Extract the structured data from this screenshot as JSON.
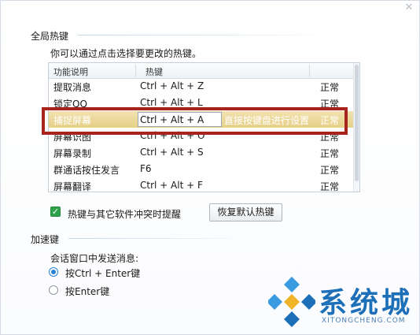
{
  "dialog": {
    "close_icon": "close-icon"
  },
  "global_hotkeys": {
    "section_title": "全局热键",
    "hint": "你可以通过点击选择要更改的热键。",
    "columns": {
      "function": "功能说明",
      "hotkey": "热键"
    },
    "rows": [
      {
        "function": "提取消息",
        "hotkey": "Ctrl + Alt + Z",
        "status": "正常"
      },
      {
        "function": "锁定QQ",
        "hotkey": "Ctrl + Alt + L",
        "status": "正常"
      },
      {
        "function": "捕捉屏幕",
        "hotkey": "Ctrl + Alt + A",
        "edit_hint": "直接按键盘进行设置",
        "status": "正常"
      },
      {
        "function": "屏幕识图",
        "hotkey": "Ctrl + Alt + O",
        "status": "正常"
      },
      {
        "function": "屏幕录制",
        "hotkey": "Ctrl + Alt + S",
        "status": "正常"
      },
      {
        "function": "群通话按住发言",
        "hotkey": "F6",
        "status": "正常"
      },
      {
        "function": "屏幕翻译",
        "hotkey": "Ctrl + Alt + F",
        "status": "正常"
      }
    ],
    "conflict_checkbox_label": "热键与其它软件冲突时提醒",
    "conflict_checked": true,
    "restore_button": "恢复默认热键"
  },
  "accelerator": {
    "section_title": "加速键",
    "send_label": "会话窗口中发送消息:",
    "options": [
      {
        "label": "按Ctrl + Enter键",
        "checked": true
      },
      {
        "label": "按Enter键",
        "checked": false
      }
    ]
  },
  "watermark": {
    "text": "系统城",
    "sub": "XITONGCHENG.COM"
  },
  "colors": {
    "highlight_border": "#a8231b",
    "selected_row": "#e6cf86",
    "check_green": "#2fa34b",
    "radio_blue": "#2c7fd3",
    "brand_blue": "#1d6fb8"
  }
}
